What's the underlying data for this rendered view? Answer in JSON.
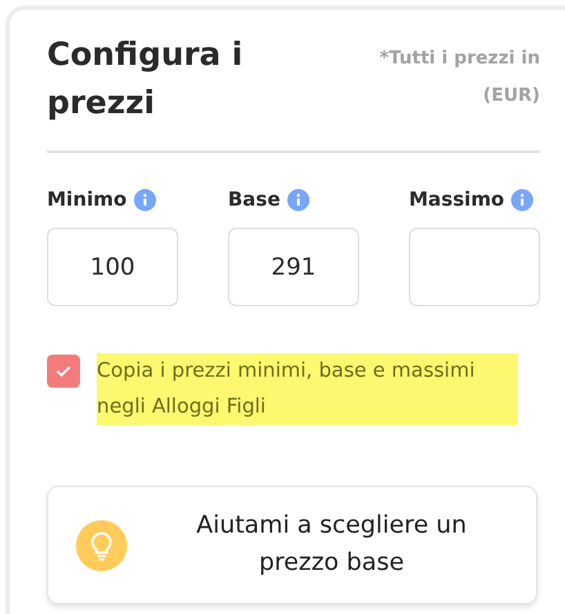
{
  "card": {
    "title": "Configura i prezzi",
    "currency_note": "*Tutti i prezzi in (EUR)"
  },
  "price_fields": [
    {
      "label": "Minimo",
      "value": "100"
    },
    {
      "label": "Base",
      "value": "291"
    },
    {
      "label": "Massimo"
    }
  ],
  "copy_option": {
    "checked": true,
    "highlighted": true,
    "label": "Copia i prezzi minimi, base e massimi negli Alloggi Figli"
  },
  "help_button": {
    "label": "Aiutami a scegliere un prezzo base"
  }
}
